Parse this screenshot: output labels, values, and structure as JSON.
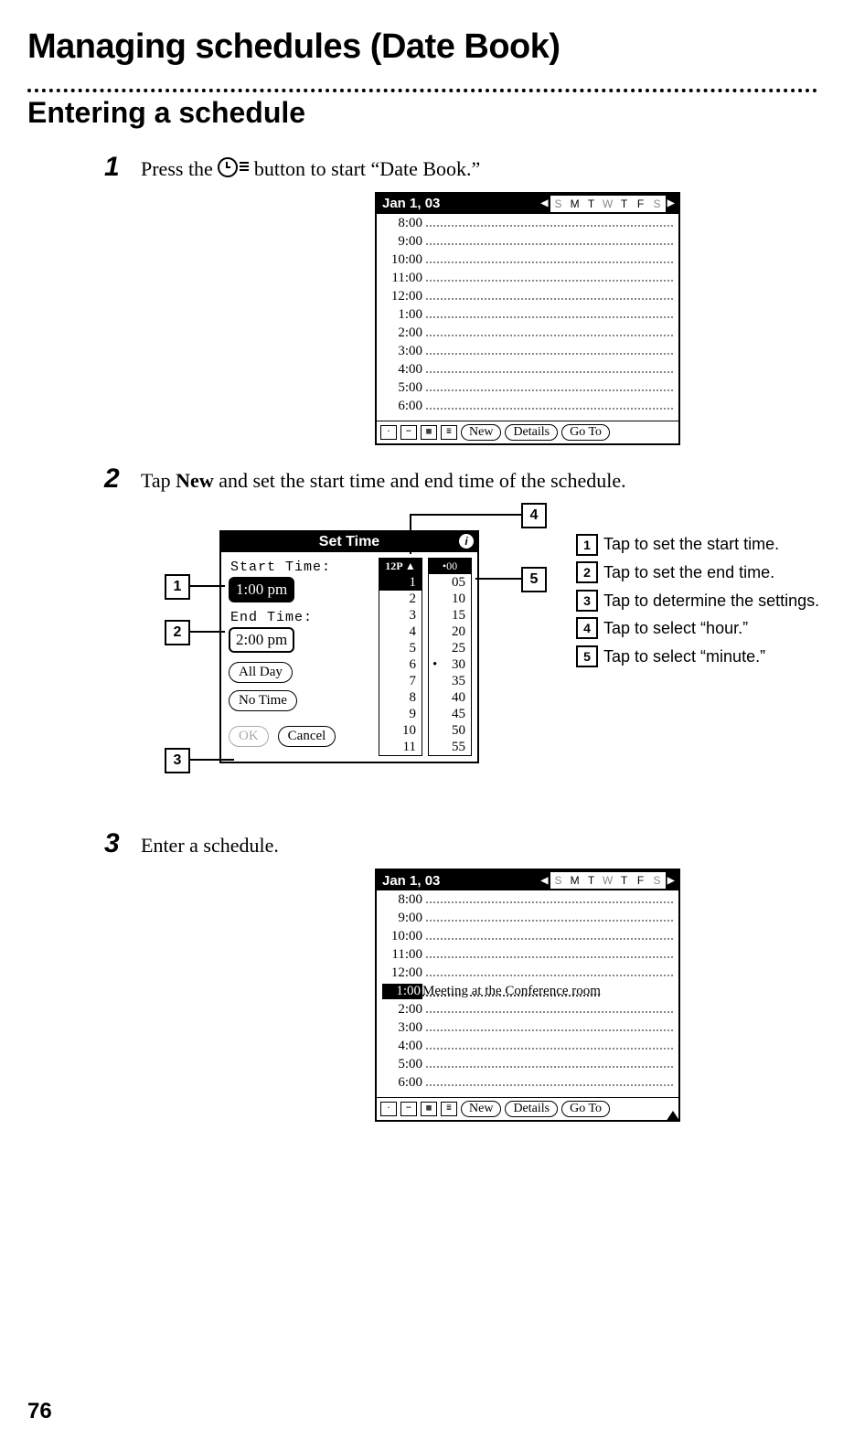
{
  "page_title": "Managing schedules (Date Book)",
  "section_title": "Entering a schedule",
  "steps": {
    "s1_num": "1",
    "s1_pre": "Press the ",
    "s1_post": " button to start “Date Book.”",
    "s2_num": "2",
    "s2_pre": "Tap ",
    "s2_bold": "New",
    "s2_post": " and set the start time and end time of the schedule.",
    "s3_num": "3",
    "s3_text": "Enter a schedule."
  },
  "dayview": {
    "date": "Jan 1, 03",
    "days": [
      "S",
      "M",
      "T",
      "W",
      "T",
      "F",
      "S"
    ],
    "times": [
      "8:00",
      "9:00",
      "10:00",
      "11:00",
      "12:00",
      "1:00",
      "2:00",
      "3:00",
      "4:00",
      "5:00",
      "6:00"
    ],
    "footer": {
      "new": "New",
      "details": "Details",
      "goto": "Go To"
    },
    "entry_time": "1:00",
    "entry_text": "Meeting at the Conference room"
  },
  "settime": {
    "title": "Set Time",
    "start_label": "Start Time:",
    "end_label": "End Time:",
    "start_value": "1:00 pm",
    "end_value": "2:00 pm",
    "all_day": "All Day",
    "no_time": "No Time",
    "ok": "OK",
    "cancel": "Cancel",
    "hour_header": "12P",
    "hours": [
      "1",
      "2",
      "3",
      "4",
      "5",
      "6",
      "7",
      "8",
      "9",
      "10",
      "11"
    ],
    "min_top": "00",
    "minutes": [
      "05",
      "10",
      "15",
      "20",
      "25",
      "30",
      "35",
      "40",
      "45",
      "50",
      "55"
    ]
  },
  "legend": {
    "l1": "Tap to set the start time.",
    "l2": "Tap to set the end time.",
    "l3": "Tap to determine the settings.",
    "l4": "Tap to select “hour.”",
    "l5": "Tap to select “minute.”",
    "n1": "1",
    "n2": "2",
    "n3": "3",
    "n4": "4",
    "n5": "5"
  },
  "page_number": "76"
}
